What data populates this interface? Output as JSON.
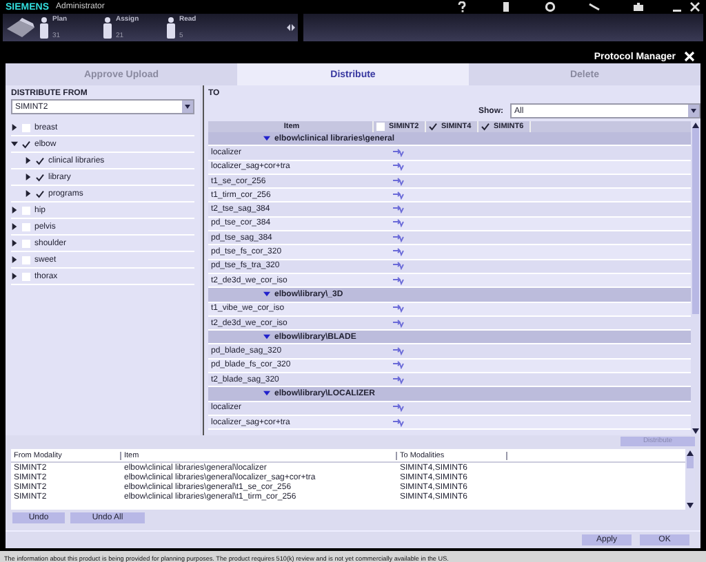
{
  "app": {
    "brand": "SIEMENS",
    "role": "Administrator"
  },
  "workflow": [
    {
      "label": "Plan",
      "count": "31"
    },
    {
      "label": "Assign",
      "count": "21"
    },
    {
      "label": "Read",
      "count": "5"
    }
  ],
  "dialog": {
    "title": "Protocol Manager"
  },
  "tabs": [
    {
      "label": "Approve Upload",
      "selected": false
    },
    {
      "label": "Distribute",
      "selected": true
    },
    {
      "label": "Delete",
      "selected": false
    }
  ],
  "source": {
    "label": "DISTRIBUTE FROM",
    "modality": "SIMINT2",
    "tree": [
      {
        "label": "breast",
        "checked": false,
        "expanded": false
      },
      {
        "label": "elbow",
        "checked": true,
        "expanded": true,
        "children": [
          {
            "label": "clinical libraries",
            "checked": true,
            "expanded": false
          },
          {
            "label": "library",
            "checked": true,
            "expanded": false
          },
          {
            "label": "programs",
            "checked": true,
            "expanded": false
          }
        ]
      },
      {
        "label": "hip",
        "checked": false,
        "expanded": false
      },
      {
        "label": "pelvis",
        "checked": false,
        "expanded": false
      },
      {
        "label": "shoulder",
        "checked": false,
        "expanded": false
      },
      {
        "label": "sweet",
        "checked": false,
        "expanded": false
      },
      {
        "label": "thorax",
        "checked": false,
        "expanded": false
      }
    ]
  },
  "target": {
    "label": "TO",
    "show_label": "Show:",
    "show_value": "All",
    "columns": [
      {
        "label": "Item"
      },
      {
        "label": "SIMINT2",
        "checked": false
      },
      {
        "label": "SIMINT4",
        "checked": true
      },
      {
        "label": "SIMINT6",
        "checked": true
      }
    ],
    "rows": [
      {
        "kind": "group",
        "label": "elbow\\clinical libraries\\general"
      },
      {
        "kind": "item",
        "label": "localizer"
      },
      {
        "kind": "item",
        "label": "localizer_sag+cor+tra"
      },
      {
        "kind": "item",
        "label": "t1_se_cor_256"
      },
      {
        "kind": "item",
        "label": "t1_tirm_cor_256"
      },
      {
        "kind": "item",
        "label": "t2_tse_sag_384"
      },
      {
        "kind": "item",
        "label": "pd_tse_cor_384"
      },
      {
        "kind": "item",
        "label": "pd_tse_sag_384"
      },
      {
        "kind": "item",
        "label": "pd_tse_fs_cor_320"
      },
      {
        "kind": "item",
        "label": "pd_tse_fs_tra_320"
      },
      {
        "kind": "item",
        "label": "t2_de3d_we_cor_iso"
      },
      {
        "kind": "group",
        "label": "elbow\\library\\_3D"
      },
      {
        "kind": "item",
        "label": "t1_vibe_we_cor_iso"
      },
      {
        "kind": "item",
        "label": "t2_de3d_we_cor_iso"
      },
      {
        "kind": "group",
        "label": "elbow\\library\\BLADE"
      },
      {
        "kind": "item",
        "label": "pd_blade_sag_320"
      },
      {
        "kind": "item",
        "label": "pd_blade_fs_cor_320"
      },
      {
        "kind": "item",
        "label": "t2_blade_sag_320"
      },
      {
        "kind": "group",
        "label": "elbow\\library\\LOCALIZER"
      },
      {
        "kind": "item",
        "label": "localizer"
      },
      {
        "kind": "item",
        "label": "localizer_sag+cor+tra"
      }
    ]
  },
  "distribute_button": {
    "label": "Distribute",
    "disabled": true
  },
  "log": {
    "columns": [
      "From Modality",
      "Item",
      "To Modalities"
    ],
    "rows": [
      {
        "from": "SIMINT2",
        "item": "elbow\\clinical libraries\\general\\localizer",
        "to": "SIMINT4,SIMINT6"
      },
      {
        "from": "SIMINT2",
        "item": "elbow\\clinical libraries\\general\\localizer_sag+cor+tra",
        "to": "SIMINT4,SIMINT6"
      },
      {
        "from": "SIMINT2",
        "item": "elbow\\clinical libraries\\general\\t1_se_cor_256",
        "to": "SIMINT4,SIMINT6"
      },
      {
        "from": "SIMINT2",
        "item": "elbow\\clinical libraries\\general\\t1_tirm_cor_256",
        "to": "SIMINT4,SIMINT6"
      }
    ]
  },
  "undo_buttons": [
    "Undo",
    "Undo All"
  ],
  "dialog_buttons": [
    "Apply",
    "OK"
  ],
  "footer": "The information about this product is being provided for planning purposes. The product requires 510(k) review and is not yet commercially available in the US."
}
